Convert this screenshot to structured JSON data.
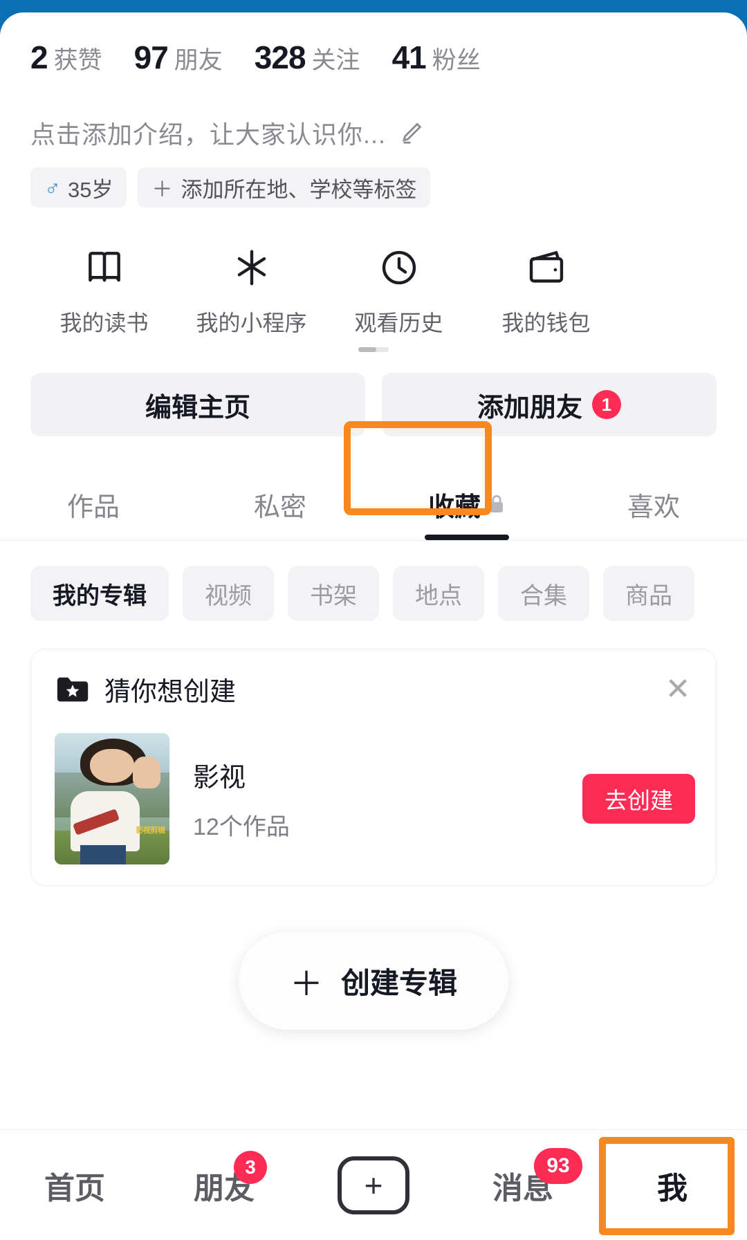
{
  "profile": {
    "stats": [
      {
        "value": "2",
        "label": "获赞"
      },
      {
        "value": "97",
        "label": "朋友"
      },
      {
        "value": "328",
        "label": "关注"
      },
      {
        "value": "41",
        "label": "粉丝"
      }
    ],
    "bio_placeholder": "点击添加介绍，让大家认识你...",
    "edit_bio_icon": "pencil-icon",
    "tags": [
      {
        "icon": "male-icon",
        "text": "35岁"
      },
      {
        "icon": "plus-icon",
        "text": "添加所在地、学校等标签"
      }
    ]
  },
  "quick_entries": [
    {
      "icon": "book-icon",
      "label": "我的读书"
    },
    {
      "icon": "mini-program-icon",
      "label": "我的小程序"
    },
    {
      "icon": "clock-icon",
      "label": "观看历史"
    },
    {
      "icon": "wallet-icon",
      "label": "我的钱包"
    }
  ],
  "actions": {
    "edit_profile": "编辑主页",
    "add_friend": "添加朋友",
    "add_friend_badge": "1"
  },
  "content_tabs": [
    {
      "label": "作品",
      "active": false,
      "locked": false
    },
    {
      "label": "私密",
      "active": false,
      "locked": false
    },
    {
      "label": "收藏",
      "active": true,
      "locked": true
    },
    {
      "label": "喜欢",
      "active": false,
      "locked": false
    }
  ],
  "filter_chips": [
    {
      "label": "我的专辑",
      "active": true
    },
    {
      "label": "视频",
      "active": false
    },
    {
      "label": "书架",
      "active": false
    },
    {
      "label": "地点",
      "active": false
    },
    {
      "label": "合集",
      "active": false
    },
    {
      "label": "商品",
      "active": false
    }
  ],
  "suggest_card": {
    "icon": "folder-star-icon",
    "title": "猜你想创建",
    "close_icon": "close-icon",
    "item": {
      "title": "影视",
      "subtitle": "12个作品",
      "thumb_overlay_text": "影视剪辑",
      "action_label": "去创建"
    }
  },
  "create_album": {
    "plus": "＋",
    "label": "创建专辑"
  },
  "bottom_nav": [
    {
      "label": "首页",
      "active": false,
      "badge": null,
      "icon": null
    },
    {
      "label": "朋友",
      "active": false,
      "badge": "3",
      "icon": null
    },
    {
      "label": null,
      "active": false,
      "badge": null,
      "icon": "plus-box-icon"
    },
    {
      "label": "消息",
      "active": false,
      "badge": "93",
      "icon": null
    },
    {
      "label": "我",
      "active": true,
      "badge": null,
      "icon": null
    }
  ],
  "colors": {
    "frame_blue": "#0b6fb4",
    "accent_red": "#fe2c55",
    "highlight_orange": "#f7871f",
    "text_primary": "#161823",
    "text_secondary": "#8a8b91",
    "chip_bg": "#f3f3f5"
  }
}
